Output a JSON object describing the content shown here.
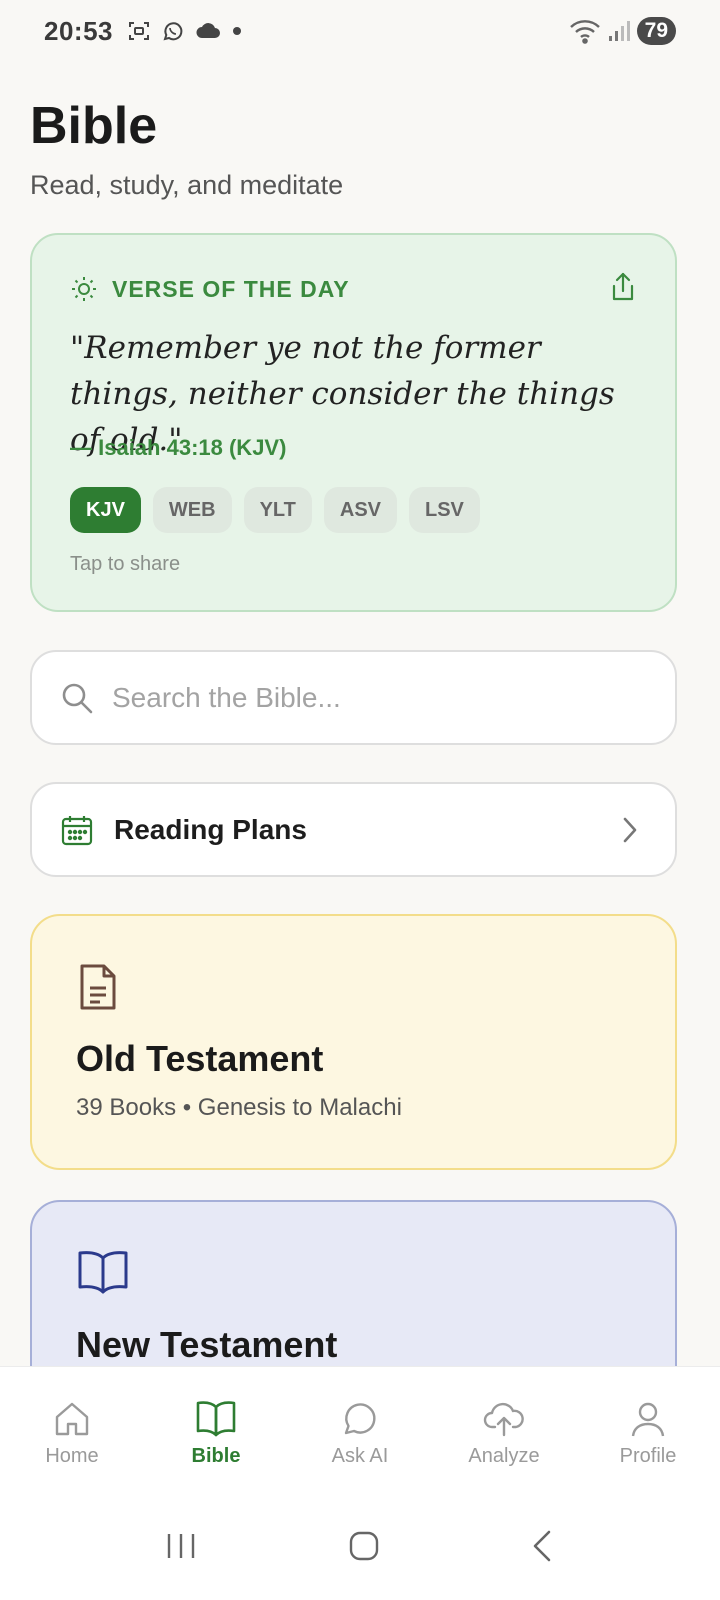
{
  "status_bar": {
    "time": "20:53",
    "battery": "79"
  },
  "header": {
    "title": "Bible",
    "subtitle": "Read, study, and meditate"
  },
  "verse_of_the_day": {
    "label": "VERSE OF THE DAY",
    "text": "\"Remember ye not the former things, neither consider the things of old.\"",
    "reference": "— Isaiah 43:18 (KJV)",
    "translations": [
      "KJV",
      "WEB",
      "YLT",
      "ASV",
      "LSV"
    ],
    "selected_translation": "KJV",
    "hint": "Tap to share",
    "accent_color": "#2e7d32"
  },
  "search": {
    "placeholder": "Search the Bible...",
    "value": ""
  },
  "reading_plans": {
    "label": "Reading Plans"
  },
  "testaments": {
    "old": {
      "title": "Old Testament",
      "subtitle": "39 Books • Genesis to Malachi",
      "icon": "document-icon"
    },
    "new": {
      "title": "New Testament",
      "icon": "open-book-icon"
    }
  },
  "bottom_nav": {
    "items": [
      {
        "label": "Home",
        "icon": "home-icon"
      },
      {
        "label": "Bible",
        "icon": "book-icon"
      },
      {
        "label": "Ask AI",
        "icon": "chat-icon"
      },
      {
        "label": "Analyze",
        "icon": "cloud-upload-icon"
      },
      {
        "label": "Profile",
        "icon": "person-icon"
      }
    ],
    "active": "Bible"
  }
}
